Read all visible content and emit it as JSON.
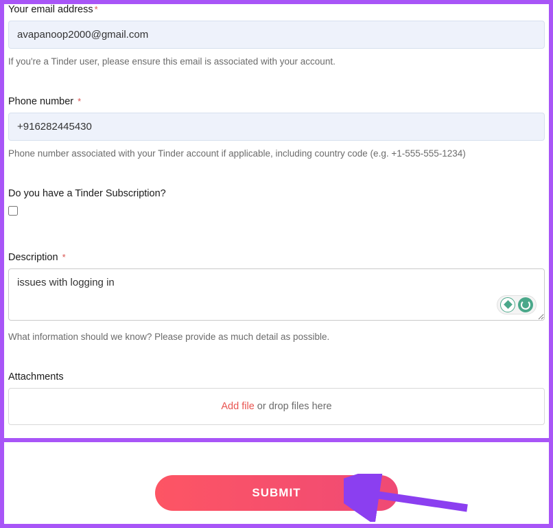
{
  "email": {
    "label": "Your email address",
    "value": "avapanoop2000@gmail.com",
    "help": "If you're a Tinder user, please ensure this email is associated with your account."
  },
  "phone": {
    "label": "Phone number",
    "value": "+916282445430",
    "help": "Phone number associated with your Tinder account if applicable, including country code (e.g. +1-555-555-1234)"
  },
  "subscription": {
    "label": "Do you have a Tinder Subscription?",
    "checked": false
  },
  "description": {
    "label": "Description",
    "value": "issues with logging in",
    "help": "What information should we know? Please provide as much detail as possible."
  },
  "attachments": {
    "label": "Attachments",
    "add_file": "Add file",
    "drop_text": " or drop files here"
  },
  "submit": {
    "label": "SUBMIT"
  },
  "asterisk": "*"
}
